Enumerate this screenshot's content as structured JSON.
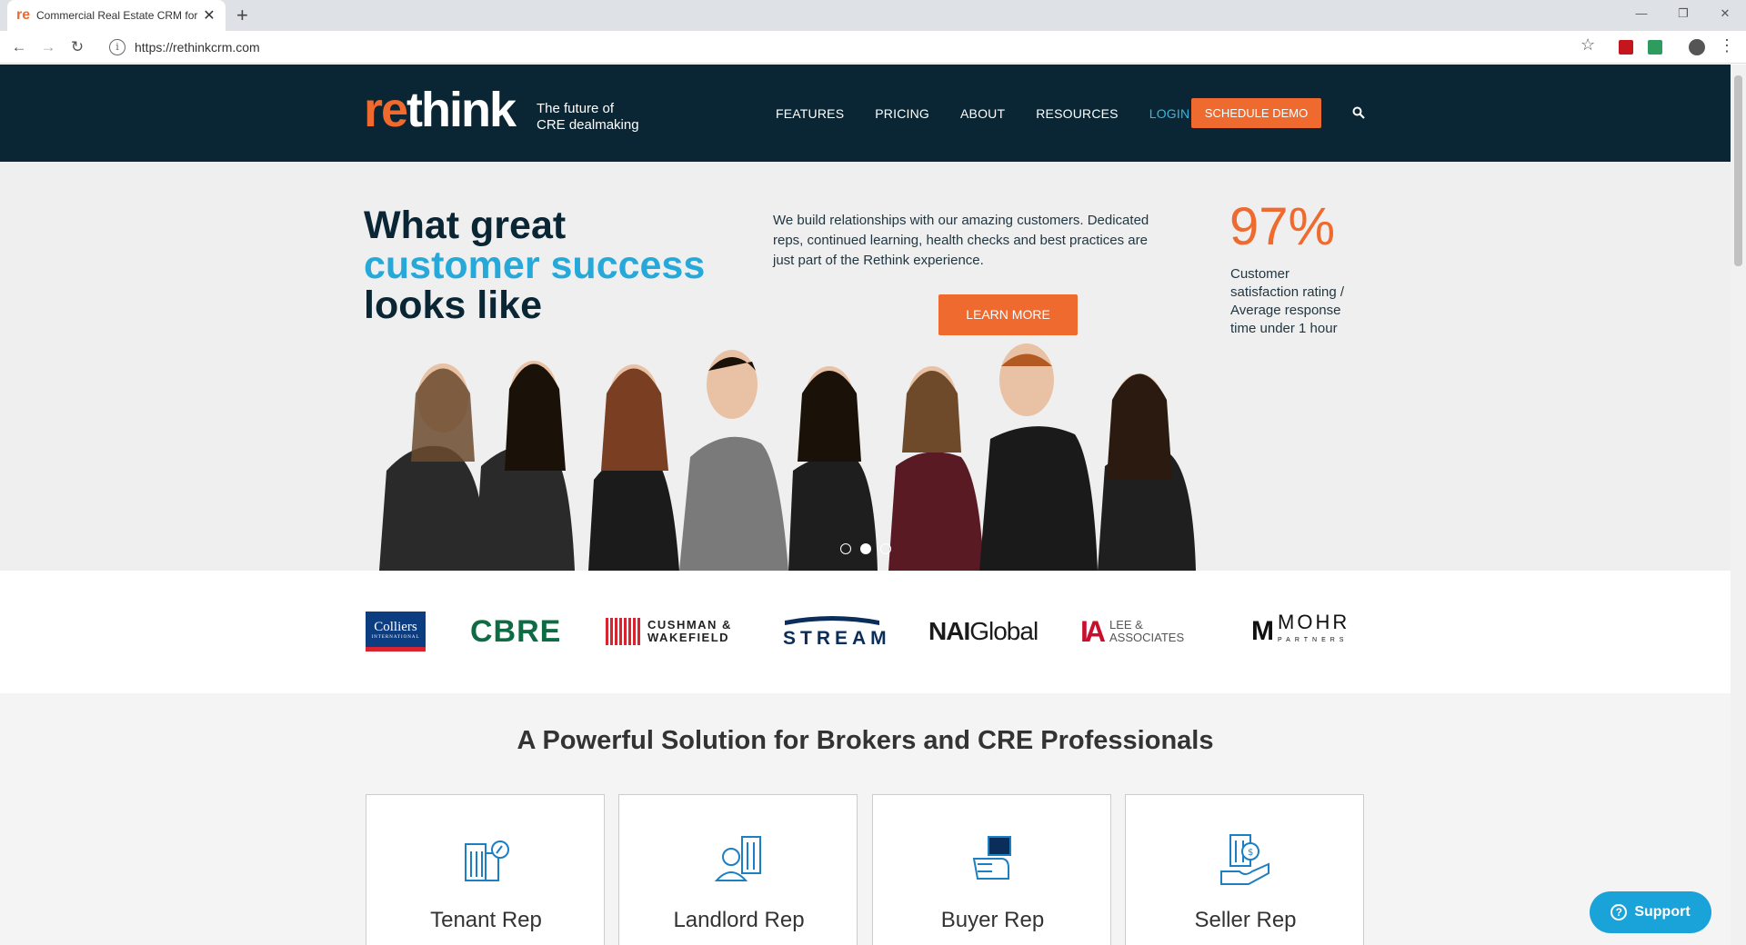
{
  "browser": {
    "tab_favicon": "re",
    "tab_title": "Commercial Real Estate CRM for",
    "url": "https://rethinkcrm.com"
  },
  "header": {
    "logo_prefix": "re",
    "logo_suffix": "think",
    "tagline_line1": "The future of",
    "tagline_line2": "CRE dealmaking",
    "nav": [
      "FEATURES",
      "PRICING",
      "ABOUT",
      "RESOURCES",
      "LOGIN"
    ],
    "cta": "SCHEDULE DEMO",
    "colors": {
      "bg": "#0a2634",
      "accent": "#ef6a2f",
      "login": "#3ab6e0"
    }
  },
  "hero": {
    "title_part1": "What great ",
    "title_highlight": "customer success",
    "title_part2": " looks like",
    "body": "We build relationships with our amazing customers. Dedicated reps, continued learning, health checks and best practices are just part of the Rethink experience.",
    "button": "LEARN MORE",
    "stat": "97%",
    "stat_caption": "Customer satisfaction rating / Average response time under 1 hour",
    "carousel_active_index": 1
  },
  "client_logos": {
    "colliers": "Colliers",
    "colliers_sub": "INTERNATIONAL",
    "cbre": "CBRE",
    "cushman_line1": "CUSHMAN &",
    "cushman_line2": "WAKEFIELD",
    "stream": "STREAM",
    "nai_1": "NAI",
    "nai_2": "Global",
    "lee_line1": "LEE &",
    "lee_line2": "ASSOCIATES",
    "mohr": "MOHR",
    "mohr_sub": "PARTNERS"
  },
  "solutions": {
    "title": "A Powerful Solution for Brokers and CRE Professionals",
    "cards": [
      {
        "label": "Tenant Rep",
        "icon": "building-key-icon"
      },
      {
        "label": "Landlord Rep",
        "icon": "landlord-buildings-icon"
      },
      {
        "label": "Buyer Rep",
        "icon": "buyer-hand-icon"
      },
      {
        "label": "Seller Rep",
        "icon": "seller-hand-dollar-icon"
      }
    ]
  },
  "support": {
    "label": "Support"
  }
}
